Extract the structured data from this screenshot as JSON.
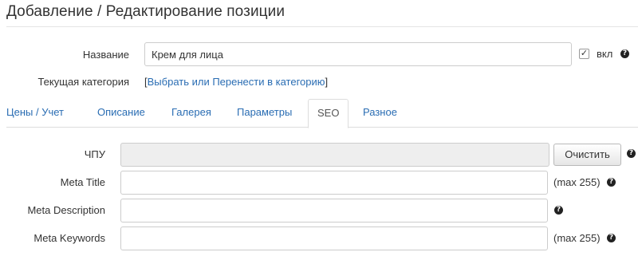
{
  "page": {
    "title": "Добавление / Редактирование позиции"
  },
  "form": {
    "name": {
      "label": "Название",
      "value": "Крем для лица",
      "enabled_label": "вкл",
      "enabled_checked": true,
      "check_mark": "✓"
    },
    "category": {
      "label": "Текущая категория",
      "bracket_open": "[",
      "link_text": "Выбрать или Перенести в категорию",
      "bracket_close": "]"
    }
  },
  "tabs": [
    {
      "label": "Цены / Учет",
      "active": false
    },
    {
      "label": "Описание",
      "active": false
    },
    {
      "label": "Галерея",
      "active": false
    },
    {
      "label": "Параметры",
      "active": false
    },
    {
      "label": "SEO",
      "active": true
    },
    {
      "label": "Разное",
      "active": false
    }
  ],
  "seo": {
    "slug": {
      "label": "ЧПУ",
      "value": "",
      "clear_button": "Очистить"
    },
    "meta_title": {
      "label": "Meta Title",
      "value": "",
      "note": "(max 255)"
    },
    "meta_description": {
      "label": "Meta Description",
      "value": ""
    },
    "meta_keywords": {
      "label": "Meta Keywords",
      "value": "",
      "note": "(max 255)"
    }
  },
  "help_glyph": "?"
}
